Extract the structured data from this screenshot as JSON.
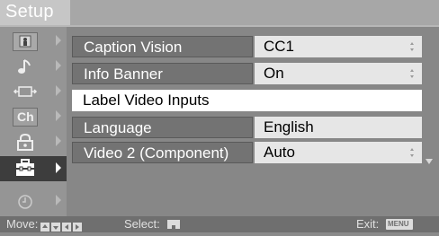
{
  "title": "Setup",
  "sidebar": {
    "items": [
      {
        "icon": "picture-icon",
        "active": false
      },
      {
        "icon": "music-note-icon",
        "active": false
      },
      {
        "icon": "screen-icon",
        "active": false
      },
      {
        "icon": "channel-icon",
        "label": "Ch",
        "active": false
      },
      {
        "icon": "lock-icon",
        "active": false
      },
      {
        "icon": "toolbox-icon",
        "active": true
      },
      {
        "icon": "clock-icon",
        "active": false
      }
    ]
  },
  "menu": {
    "rows": [
      {
        "label": "Caption Vision",
        "value": "CC1"
      },
      {
        "label": "Info Banner",
        "value": "On"
      },
      {
        "label": "Label Video Inputs",
        "value": ""
      },
      {
        "label": "Language",
        "value": "English"
      },
      {
        "label": "Video 2 (Component)",
        "value": "Auto"
      }
    ]
  },
  "footer": {
    "move_label": "Move:",
    "select_label": "Select:",
    "exit_label": "Exit:",
    "menu_key": "MENU"
  }
}
